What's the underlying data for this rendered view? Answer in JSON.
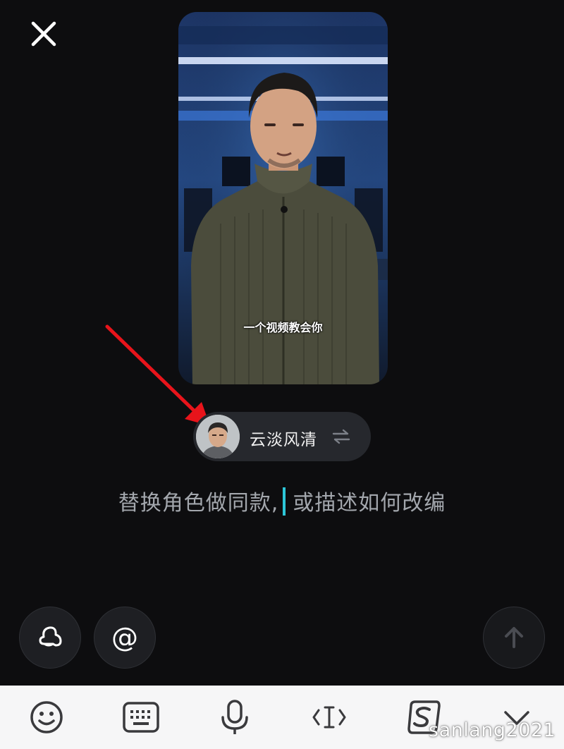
{
  "header": {
    "close_icon": "close-icon"
  },
  "video": {
    "caption": "一个视频教会你"
  },
  "role": {
    "name": "云淡风清",
    "swap_icon": "swap-arrows-icon"
  },
  "prompt": {
    "placeholder_part1": "替换角色做同款,",
    "placeholder_part2": "或描述如何改编",
    "caret_color": "#2dc6d8"
  },
  "actions": {
    "character_icon": "ghost-hat-icon",
    "mention_label": "@",
    "send_icon": "arrow-up-icon"
  },
  "keyboard_toolbar": {
    "icons": [
      "emoji-icon",
      "keyboard-icon",
      "microphone-icon",
      "text-cursor-icon",
      "sogou-s-icon",
      "collapse-chevron-icon"
    ]
  },
  "watermark": "sanlang2021"
}
